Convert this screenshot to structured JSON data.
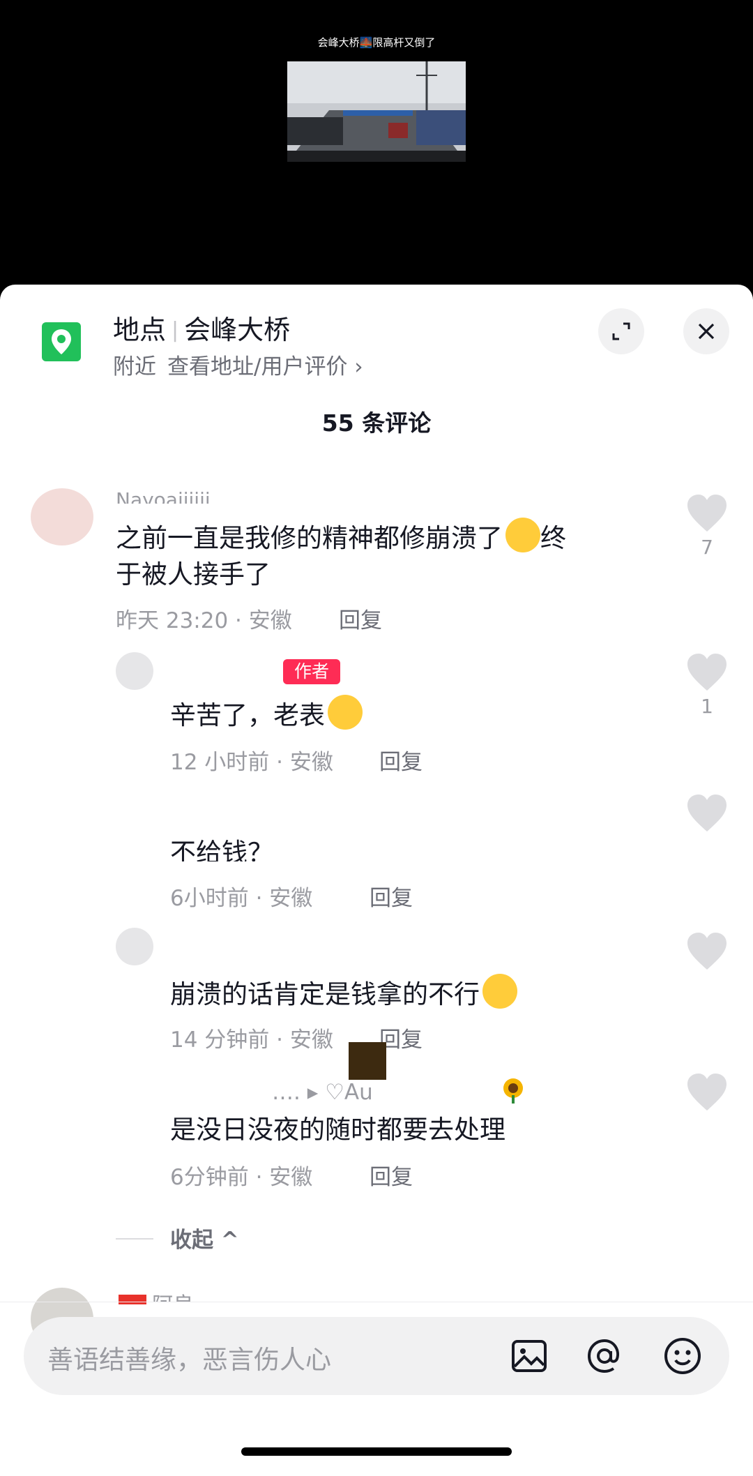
{
  "video": {
    "title": "会峰大桥🌉限高杆又倒了"
  },
  "location": {
    "label": "地点",
    "name": "会峰大桥",
    "nearby": "附近",
    "address_link": "查看地址/用户评价 ›"
  },
  "comments_count": "55 条评论",
  "comments": [
    {
      "user": "Nayoaiiiiii",
      "text": "之前一直是我修的精神都修崩溃了😭终于被人接手了",
      "text_line1": "之前一直是我修的精神都修崩溃了",
      "text_line1_end": "终",
      "text_line2": "于被人接手了",
      "meta": "昨天 23:20 · 安徽",
      "reply": "回复",
      "likes": "7"
    },
    {
      "badge": "作者",
      "text": "辛苦了，老表",
      "meta": "12 小时前 · 安徽",
      "reply": "回复",
      "likes": "1"
    },
    {
      "text": "不给钱？",
      "meta": "6小时前 · 安徽",
      "reply": "回复"
    },
    {
      "text": "崩溃的话肯定是钱拿的不行",
      "meta": "14 分钟前 · 安徽",
      "reply": "回复"
    },
    {
      "user_ref": "…. ▸ ♡Au",
      "text": "是没日没夜的随时都要去处理",
      "meta": "6分钟前 · 安徽",
      "reply": "回复"
    }
  ],
  "collapse": "收起 ^",
  "next_comment_user": "阿良",
  "input": {
    "placeholder": "善语结善缘，恶言伤人心"
  }
}
